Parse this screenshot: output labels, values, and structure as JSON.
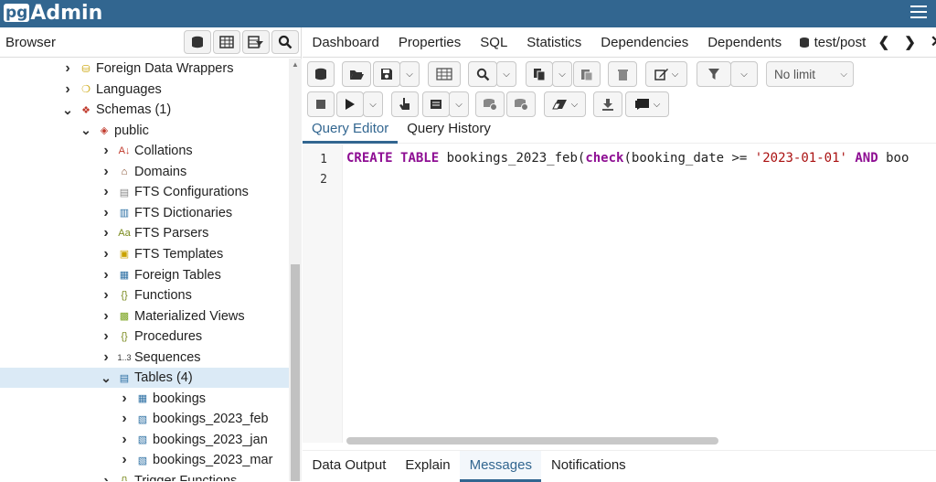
{
  "app": {
    "logo_pg": "pg",
    "logo_admin": "Admin"
  },
  "browser": {
    "title": "Browser"
  },
  "tree": [
    {
      "label": "Foreign Data Wrappers",
      "expanded": false,
      "icon": "foreign-data-wrapper-icon"
    },
    {
      "label": "Languages",
      "expanded": false,
      "icon": "language-icon"
    },
    {
      "label": "Schemas (1)",
      "expanded": true,
      "icon": "schemas-icon"
    },
    {
      "label": "public",
      "expanded": true,
      "icon": "schema-icon"
    },
    {
      "label": "Collations",
      "expanded": false,
      "icon": "collation-icon"
    },
    {
      "label": "Domains",
      "expanded": false,
      "icon": "domain-icon"
    },
    {
      "label": "FTS Configurations",
      "expanded": false,
      "icon": "fts-config-icon"
    },
    {
      "label": "FTS Dictionaries",
      "expanded": false,
      "icon": "fts-dictionary-icon"
    },
    {
      "label": "FTS Parsers",
      "expanded": false,
      "icon": "fts-parser-icon"
    },
    {
      "label": "FTS Templates",
      "expanded": false,
      "icon": "fts-template-icon"
    },
    {
      "label": "Foreign Tables",
      "expanded": false,
      "icon": "foreign-table-icon"
    },
    {
      "label": "Functions",
      "expanded": false,
      "icon": "function-icon"
    },
    {
      "label": "Materialized Views",
      "expanded": false,
      "icon": "mview-icon"
    },
    {
      "label": "Procedures",
      "expanded": false,
      "icon": "procedure-icon"
    },
    {
      "label": "Sequences",
      "expanded": false,
      "icon": "sequence-icon"
    },
    {
      "label": "Tables (4)",
      "expanded": true,
      "selected": true,
      "icon": "tables-icon"
    },
    {
      "label": "bookings",
      "expanded": false,
      "icon": "table-icon"
    },
    {
      "label": "bookings_2023_feb",
      "expanded": false,
      "icon": "partition-icon"
    },
    {
      "label": "bookings_2023_jan",
      "expanded": false,
      "icon": "partition-icon"
    },
    {
      "label": "bookings_2023_mar",
      "expanded": false,
      "icon": "partition-icon"
    },
    {
      "label": "Trigger Functions",
      "expanded": false,
      "icon": "trigger-function-icon"
    }
  ],
  "tabs": [
    "Dashboard",
    "Properties",
    "SQL",
    "Statistics",
    "Dependencies",
    "Dependents",
    "test/post"
  ],
  "toolbar": {
    "limit_select": "No limit"
  },
  "query_tabs": [
    "Query Editor",
    "Query History"
  ],
  "editor": {
    "line_numbers": [
      "1",
      "2"
    ],
    "line1": {
      "kw1": "CREATE",
      "sp1": " ",
      "kw2": "TABLE",
      "t1": " bookings_2023_feb(",
      "kw3": "check",
      "t2": "(booking_date >= ",
      "str1": "'2023-01-01'",
      "sp2": " ",
      "kw4": "AND",
      "t3": " boo"
    }
  },
  "bottom_tabs": [
    "Data Output",
    "Explain",
    "Messages",
    "Notifications"
  ],
  "colors": {
    "header": "#326690",
    "keyword": "#8e0e93",
    "string": "#a11111",
    "selection": "#dbeaf6"
  }
}
